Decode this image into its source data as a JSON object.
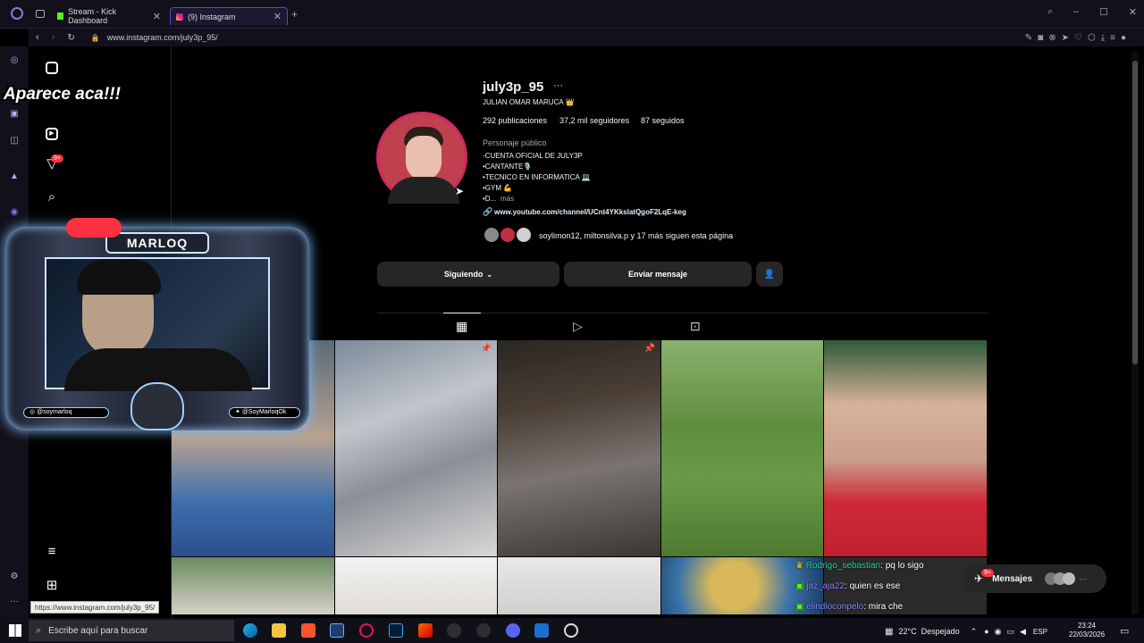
{
  "browser": {
    "tabs": [
      {
        "label": "Stream - Kick Dashboard"
      },
      {
        "label": "(9) Instagram"
      }
    ],
    "url": "www.instagram.com/july3p_95/",
    "status_url": "https://www.instagram.com/july3p_95/"
  },
  "sidebar": {
    "notification_badge": "9+"
  },
  "profile": {
    "username": "july3p_95",
    "more": "···",
    "full_name": "JULIAN OMAR MARUCA 👑",
    "posts": "292 publicaciones",
    "followers": "37,2 mil seguidores",
    "following": "87 seguidos",
    "category": "Personaje público",
    "bio_lines": [
      "-CUENTA OFICIAL DE JULY3P",
      "•CANTANTE🎙️",
      "•TECNICO EN INFORMATICA 💻",
      "•GYM 💪",
      "•D..."
    ],
    "bio_more": "más",
    "link": "www.youtube.com/channel/UCnt4YKkslatQgoF2LqE-keg",
    "followed_by": "soylimon12, miltonsilva.p y 17 más siguen esta página"
  },
  "actions": {
    "following_label": "Siguiendo",
    "message_label": "Enviar mensaje"
  },
  "overlay": {
    "caption": "Aparece aca!!!",
    "streamer_name": "MARLOQ",
    "ig_handle": "@soymarloq",
    "tw_handle": "@SoyMarloqOk"
  },
  "chat": [
    {
      "user": "Rodrigo_sebastian",
      "msg": ": pq lo sigo"
    },
    {
      "user": "jaz_aja22",
      "msg": ": quien es ese"
    },
    {
      "user": "elindioconpelo",
      "msg": ": mira che"
    }
  ],
  "messages_panel": {
    "label": "Mensajes",
    "badge": "9+"
  },
  "taskbar": {
    "search_placeholder": "Escribe aquí para buscar",
    "weather": "22°C  Despejado",
    "lang": "ESP",
    "time": "23:24",
    "date": "22/03/2026"
  },
  "colors": {
    "accent": "#6a3fd0",
    "link": "#e0f1ff",
    "badge": "#ff3040"
  }
}
